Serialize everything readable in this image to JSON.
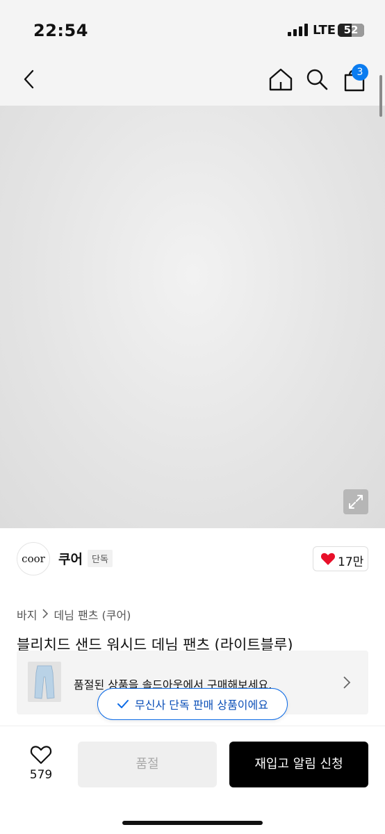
{
  "status_bar": {
    "time": "22:54",
    "network": "LTE",
    "battery_level": "52"
  },
  "nav": {
    "cart_count": "3",
    "icons": [
      "back-arrow-icon",
      "home-icon",
      "search-icon",
      "cart-icon"
    ]
  },
  "product_image": {
    "subject": "light blue denim pants",
    "expand_icon": "expand-icon"
  },
  "brand": {
    "logo_text": "coor",
    "name": "쿠어",
    "badge": "단독",
    "like_count": "17만"
  },
  "breadcrumb": [
    "바지",
    "데님 팬츠 (쿠어)"
  ],
  "product": {
    "title": "블리치드 샌드 워시드 데님 팬츠 (라이트블루)"
  },
  "soldout_banner": {
    "text": "품절된 상품을 솔드아웃에서 구매해보세요."
  },
  "exclusive_notice": {
    "text": "무신사 단독 판매 상품이에요"
  },
  "bottom_bar": {
    "wish_count": "579",
    "soldout_label": "품절",
    "restock_label": "재입고 알림 신청"
  },
  "colors": {
    "accent_blue": "#0b6ae6",
    "badge_blue": "#0b7cf0",
    "heart_red": "#e8102a",
    "denim_light": "#b9d2e6"
  }
}
